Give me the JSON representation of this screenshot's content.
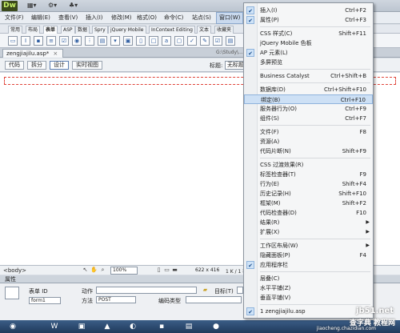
{
  "app": {
    "logo": "Dw"
  },
  "menubar": {
    "items": [
      "文件(F)",
      "编辑(E)",
      "查看(V)",
      "插入(I)",
      "修改(M)",
      "格式(O)",
      "命令(C)",
      "站点(S)",
      "窗口(W)"
    ]
  },
  "insert_tabs": [
    "常用",
    "布局",
    "表单",
    "ASP",
    "数据",
    "Spry",
    "jQuery Mobile",
    "InContext Editing",
    "文本",
    "收藏夹"
  ],
  "document": {
    "tab_name": "zengjiajilu.asp*",
    "path": "G:\\Study\\..."
  },
  "view_buttons": [
    "代码",
    "拆分",
    "设计",
    "实时视图"
  ],
  "title_label": "标题:",
  "title_value": "无标题",
  "statusbar": {
    "tag": "<body>",
    "zoom": "100%",
    "size": "622 x 416",
    "extra": "1 K / 1 秒"
  },
  "properties": {
    "header": "属性",
    "form_id_label": "表单 ID",
    "form_id_value": "form1",
    "action_label": "动作",
    "method_label": "方法",
    "method_value": "POST",
    "enctype_label": "编码类型",
    "target_label": "目标(T)"
  },
  "window_menu": {
    "items": [
      {
        "label": "插入(I)",
        "shortcut": "Ctrl+F2",
        "checked": true
      },
      {
        "label": "属性(P)",
        "shortcut": "Ctrl+F3",
        "checked": true
      },
      {
        "sep": true
      },
      {
        "label": "CSS 样式(C)",
        "shortcut": "Shift+F11"
      },
      {
        "label": "jQuery Mobile 色板",
        "shortcut": ""
      },
      {
        "label": "AP 元素(L)",
        "shortcut": "",
        "checked": true
      },
      {
        "label": "多屏预览",
        "shortcut": ""
      },
      {
        "sep": true
      },
      {
        "label": "Business Catalyst",
        "shortcut": "Ctrl+Shift+B"
      },
      {
        "sep": true
      },
      {
        "label": "数据库(D)",
        "shortcut": "Ctrl+Shift+F10"
      },
      {
        "label": "绑定(B)",
        "shortcut": "Ctrl+F10",
        "highlight": true
      },
      {
        "label": "服务器行为(O)",
        "shortcut": "Ctrl+F9"
      },
      {
        "label": "组件(S)",
        "shortcut": "Ctrl+F7"
      },
      {
        "sep": true
      },
      {
        "label": "文件(F)",
        "shortcut": "F8"
      },
      {
        "label": "资源(A)",
        "shortcut": ""
      },
      {
        "label": "代码片断(N)",
        "shortcut": "Shift+F9"
      },
      {
        "sep": true
      },
      {
        "label": "CSS 过渡效果(R)",
        "shortcut": ""
      },
      {
        "label": "标签检查器(T)",
        "shortcut": "F9"
      },
      {
        "label": "行为(E)",
        "shortcut": "Shift+F4"
      },
      {
        "label": "历史记录(H)",
        "shortcut": "Shift+F10"
      },
      {
        "label": "框架(M)",
        "shortcut": "Shift+F2"
      },
      {
        "label": "代码检查器(D)",
        "shortcut": "F10"
      },
      {
        "label": "结果(R)",
        "shortcut": "",
        "submenu": true
      },
      {
        "label": "扩展(X)",
        "shortcut": "",
        "submenu": true
      },
      {
        "sep": true
      },
      {
        "label": "工作区布局(W)",
        "shortcut": "",
        "submenu": true
      },
      {
        "label": "隐藏面板(P)",
        "shortcut": "F4"
      },
      {
        "label": "应用程序栏",
        "shortcut": "",
        "checked": true
      },
      {
        "sep": true
      },
      {
        "label": "层叠(C)",
        "shortcut": ""
      },
      {
        "label": "水平平铺(Z)",
        "shortcut": ""
      },
      {
        "label": "垂直平铺(V)",
        "shortcut": ""
      },
      {
        "sep": true
      },
      {
        "label": "1 zengjiajilu.asp",
        "shortcut": "",
        "checked": true
      }
    ]
  },
  "watermark": {
    "line1": "jb51.net",
    "line2": "查字典 教程网",
    "url": "jiaocheng.chazidian.com"
  }
}
